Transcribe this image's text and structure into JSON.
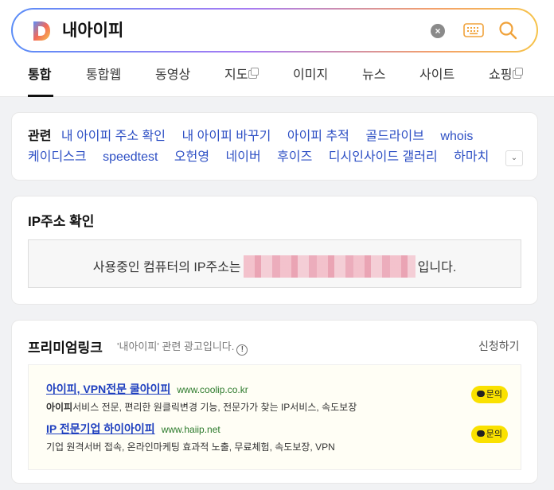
{
  "search": {
    "query": "내아이피"
  },
  "tabs": [
    {
      "label": "통합"
    },
    {
      "label": "통합웹"
    },
    {
      "label": "동영상"
    },
    {
      "label": "지도"
    },
    {
      "label": "이미지"
    },
    {
      "label": "뉴스"
    },
    {
      "label": "사이트"
    },
    {
      "label": "쇼핑"
    }
  ],
  "related": {
    "title": "관련",
    "line1": [
      "내 아이피 주소 확인",
      "내 아이피 바꾸기",
      "아이피 추적",
      "골드라이브",
      "whois"
    ],
    "line2": [
      "케이디스크",
      "speedtest",
      "오헌영",
      "네이버",
      "후이즈",
      "디시인사이드 갤러리",
      "하마치"
    ]
  },
  "ip_check": {
    "title": "IP주소 확인",
    "prefix": "사용중인 컴퓨터의 IP주소는",
    "suffix": "입니다."
  },
  "ads": {
    "title": "프리미엄링크",
    "desc": "'내아이피' 관련 광고입니다.",
    "info_icon": "!",
    "apply": "신청하기",
    "inquiry": "문의",
    "items": [
      {
        "link": "아이피, VPN전문 쿨아이피",
        "url": "www.coolip.co.kr",
        "bold": "아이피",
        "desc": "서비스 전문, 편리한 원클릭변경 기능, 전문가가 찾는 IP서비스, 속도보장"
      },
      {
        "link": "IP 전문기업 하이아이피",
        "url": "www.haiip.net",
        "bold": "",
        "desc": "기업 원격서버 접속, 온라인마케팅 효과적 노출, 무료체험, 속도보장, VPN"
      }
    ]
  },
  "colors": {
    "link": "#2d4fc4",
    "ad_link": "#1e3fbf",
    "ad_url": "#2c7a2c",
    "inquiry_bg": "#fae100"
  }
}
